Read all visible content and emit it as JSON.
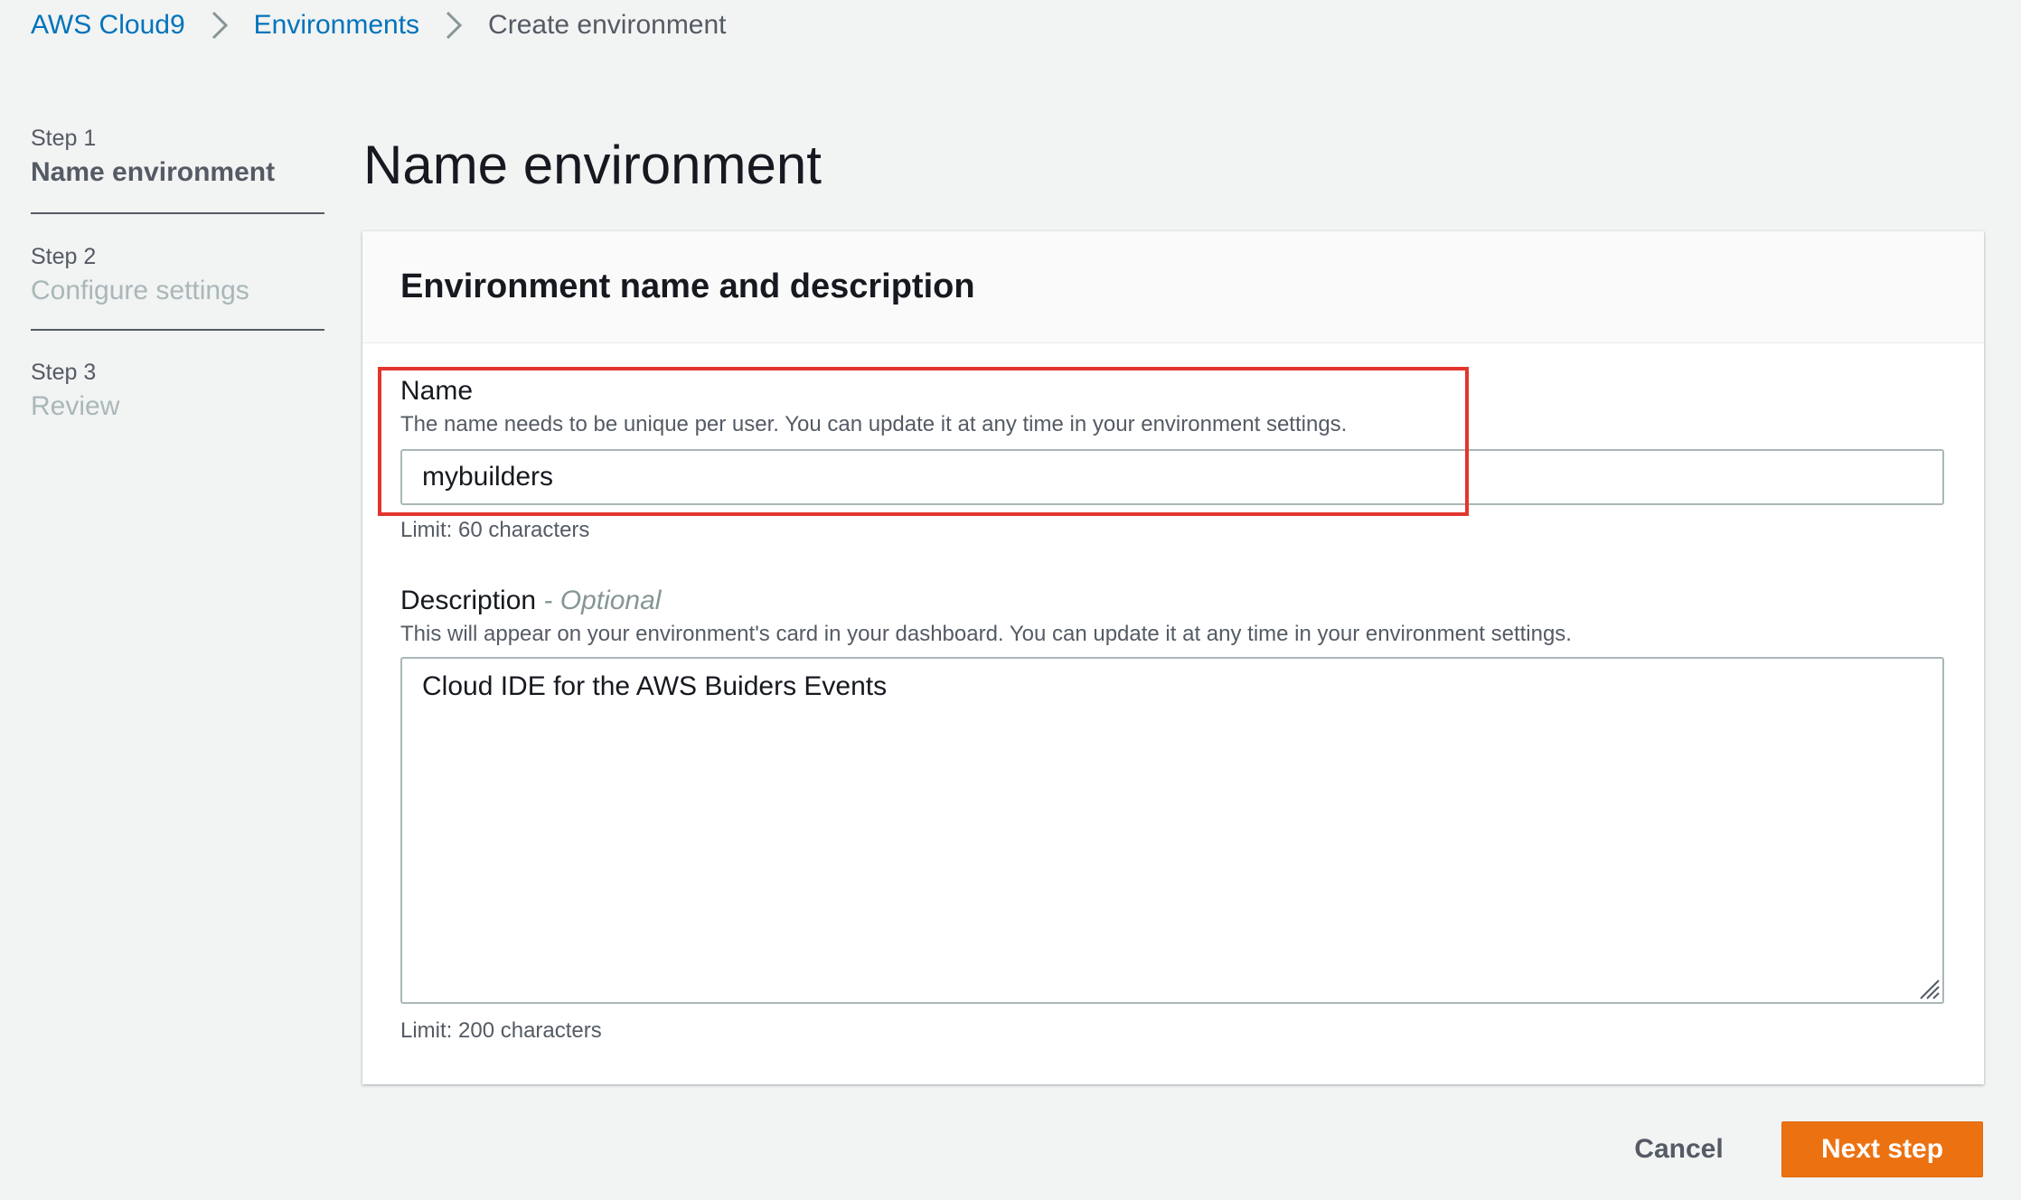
{
  "breadcrumb": {
    "items": [
      {
        "label": "AWS Cloud9"
      },
      {
        "label": "Environments"
      },
      {
        "label": "Create environment"
      }
    ],
    "separator_icon": "chevron-right-icon"
  },
  "steps": [
    {
      "number": "Step 1",
      "title": "Name environment",
      "active": true
    },
    {
      "number": "Step 2",
      "title": "Configure settings",
      "active": false
    },
    {
      "number": "Step 3",
      "title": "Review",
      "active": false
    }
  ],
  "page": {
    "title": "Name environment"
  },
  "panel": {
    "title": "Environment name and description",
    "name_field": {
      "label": "Name",
      "help": "The name needs to be unique per user. You can update it at any time in your environment settings.",
      "value": "mybuilders",
      "limit": "Limit: 60 characters"
    },
    "description_field": {
      "label": "Description",
      "optional": "- Optional",
      "help": "This will appear on your environment's card in your dashboard. You can update it at any time in your environment settings.",
      "value": "Cloud IDE for the AWS Buiders Events",
      "limit": "Limit: 200 characters"
    }
  },
  "actions": {
    "cancel_label": "Cancel",
    "next_label": "Next step"
  },
  "colors": {
    "link": "#0073bb",
    "primary_button": "#ec7211",
    "highlight": "#e3352d",
    "background": "#f2f3f3"
  }
}
